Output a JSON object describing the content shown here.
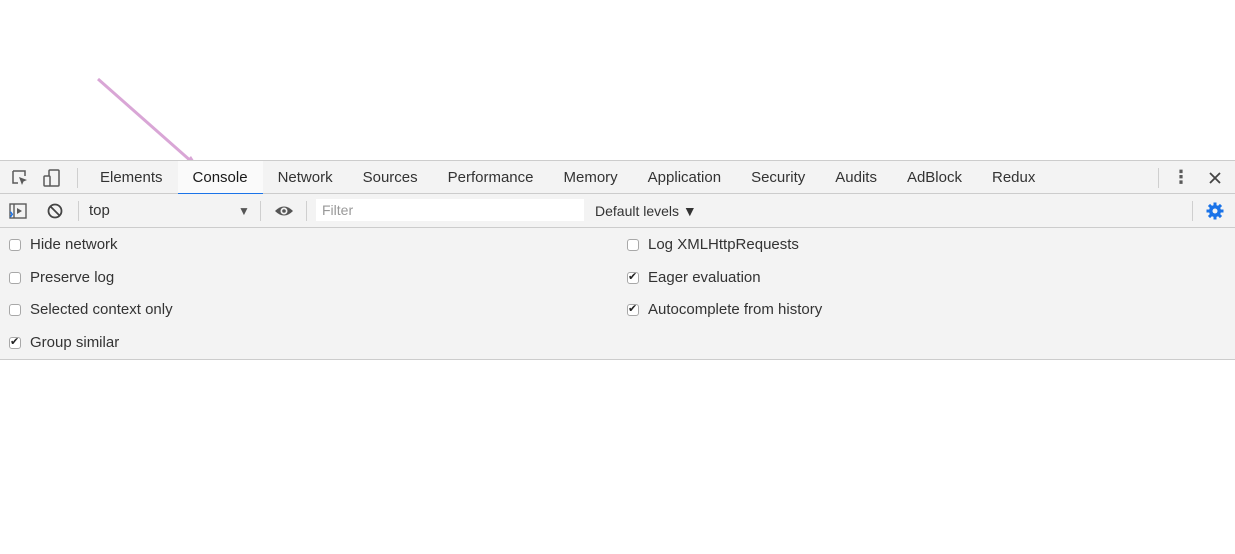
{
  "tabs": [
    "Elements",
    "Console",
    "Network",
    "Sources",
    "Performance",
    "Memory",
    "Application",
    "Security",
    "Audits",
    "AdBlock",
    "Redux"
  ],
  "active_tab": "Console",
  "toolbar": {
    "context": "top",
    "filter_placeholder": "Filter",
    "levels_label": "Default levels ▼"
  },
  "settings": {
    "left": [
      {
        "label": "Hide network",
        "checked": false
      },
      {
        "label": "Preserve log",
        "checked": false
      },
      {
        "label": "Selected context only",
        "checked": false
      },
      {
        "label": "Group similar",
        "checked": true
      }
    ],
    "right": [
      {
        "label": "Log XMLHttpRequests",
        "checked": false
      },
      {
        "label": "Eager evaluation",
        "checked": true
      },
      {
        "label": "Autocomplete from history",
        "checked": true
      }
    ]
  },
  "prompt_symbol": "›",
  "colors": {
    "accent": "#1a73e8",
    "annotation_arrow": "#d9a6d6",
    "toolbar_bg": "#f3f3f3"
  }
}
